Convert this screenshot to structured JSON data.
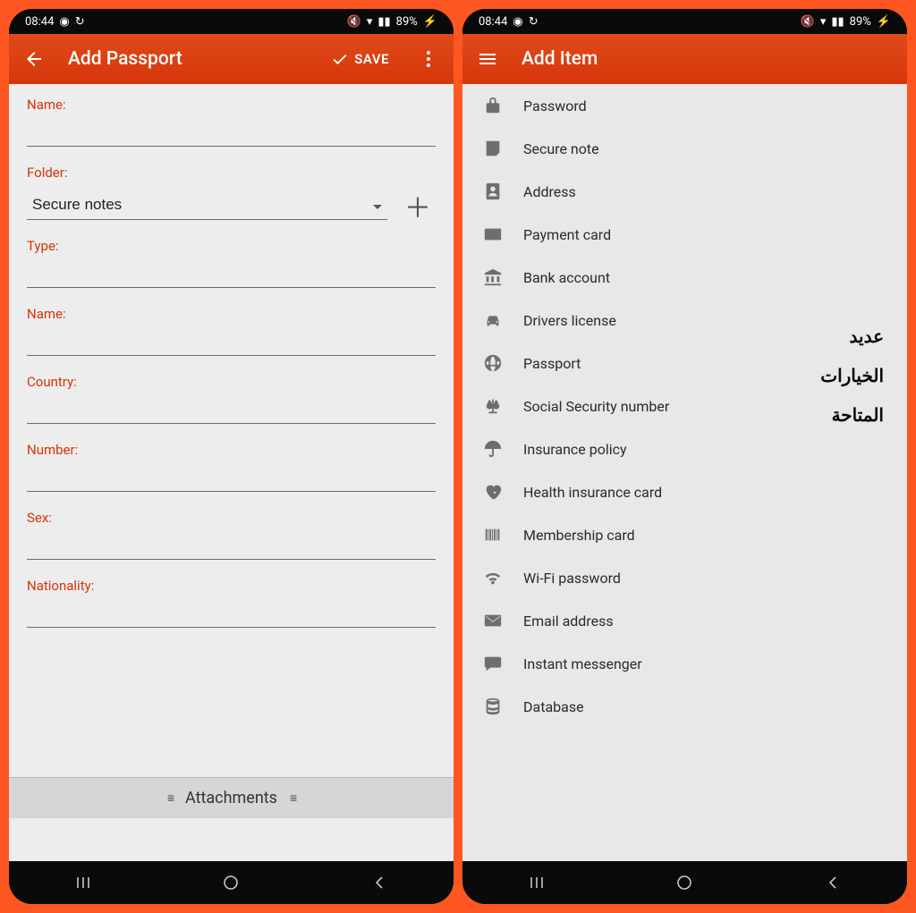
{
  "status": {
    "time": "08:44",
    "battery": "89%"
  },
  "left_screen": {
    "title": "Add Passport",
    "save_label": "SAVE",
    "fields": {
      "name1_label": "Name:",
      "folder_label": "Folder:",
      "folder_value": "Secure notes",
      "type_label": "Type:",
      "name2_label": "Name:",
      "country_label": "Country:",
      "number_label": "Number:",
      "sex_label": "Sex:",
      "nationality_label": "Nationality:"
    },
    "attachments_label": "Attachments"
  },
  "right_screen": {
    "title": "Add Item",
    "items": [
      {
        "icon": "lock-icon",
        "label": "Password"
      },
      {
        "icon": "note-icon",
        "label": "Secure note"
      },
      {
        "icon": "address-book-icon",
        "label": "Address"
      },
      {
        "icon": "credit-card-icon",
        "label": "Payment card"
      },
      {
        "icon": "bank-icon",
        "label": "Bank account"
      },
      {
        "icon": "car-icon",
        "label": "Drivers license"
      },
      {
        "icon": "globe-icon",
        "label": "Passport"
      },
      {
        "icon": "scale-icon",
        "label": "Social Security number"
      },
      {
        "icon": "umbrella-icon",
        "label": "Insurance policy"
      },
      {
        "icon": "heartbeat-icon",
        "label": "Health insurance card"
      },
      {
        "icon": "barcode-icon",
        "label": "Membership card"
      },
      {
        "icon": "wifi-icon",
        "label": "Wi-Fi password"
      },
      {
        "icon": "envelope-icon",
        "label": "Email address"
      },
      {
        "icon": "chat-icon",
        "label": "Instant messenger"
      },
      {
        "icon": "database-icon",
        "label": "Database"
      }
    ],
    "annotation": "عديد\nالخيارات\nالمتاحة"
  }
}
